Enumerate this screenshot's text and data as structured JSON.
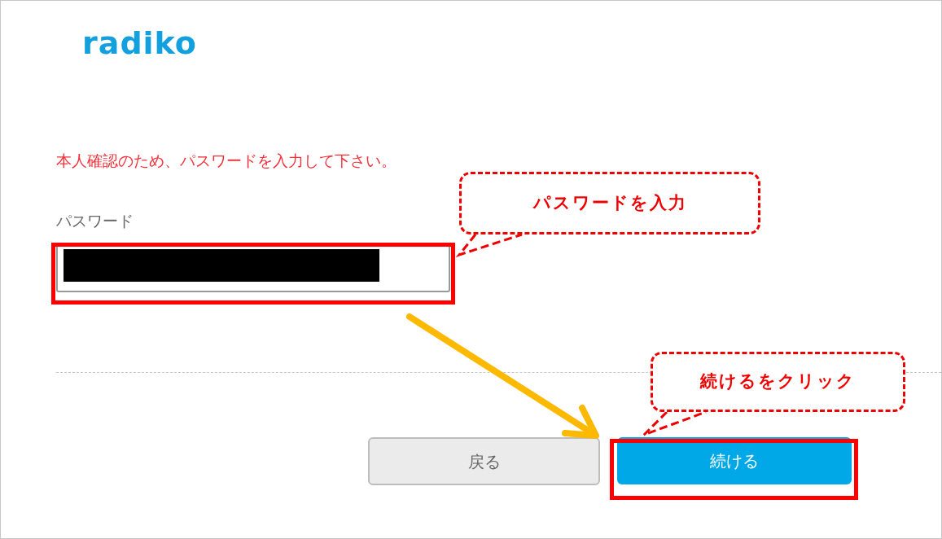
{
  "logo": {
    "text": "radiko"
  },
  "message": "本人確認のため、パスワードを入力して下さい。",
  "password": {
    "label": "パスワード",
    "value_redacted": true
  },
  "buttons": [
    {
      "label": "戻る",
      "kind": "secondary"
    },
    {
      "label": "続ける",
      "kind": "primary"
    }
  ],
  "annotations": [
    {
      "kind": "highlight"
    },
    {
      "kind": "callout",
      "text": "パスワードを入力"
    },
    {
      "kind": "arrow"
    },
    {
      "kind": "callout",
      "text": "続けるをクリック"
    },
    {
      "kind": "highlight"
    }
  ]
}
